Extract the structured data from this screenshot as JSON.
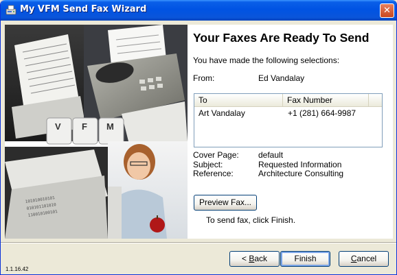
{
  "window": {
    "title": "My VFM Send Fax Wizard",
    "close_glyph": "✕",
    "icon": "fax-app-icon"
  },
  "side_image": {
    "keys": [
      "V",
      "F",
      "M"
    ],
    "description_icon": "fax-collage-image"
  },
  "panel": {
    "heading": "Your Faxes Are Ready To Send",
    "intro": "You have made the following selections:",
    "from_label": "From:",
    "from_value": "Ed Vandalay",
    "recipients": {
      "columns": [
        "To",
        "Fax Number"
      ],
      "rows": [
        {
          "to": "Art Vandalay",
          "fax": "+1 (281) 664-9987"
        }
      ]
    },
    "details": [
      {
        "label": "Cover Page:",
        "value": "default"
      },
      {
        "label": "Subject:",
        "value": "Requested Information"
      },
      {
        "label": "Reference:",
        "value": "Architecture Consulting"
      }
    ],
    "preview_button": "Preview Fax...",
    "instruction": "To send fax, click Finish."
  },
  "footer": {
    "version": "1.1.16.42",
    "back": {
      "mnemonic": "B",
      "rest": "ack",
      "prefix": "< "
    },
    "finish": "Finish",
    "cancel": {
      "mnemonic": "C",
      "rest": "ancel"
    }
  },
  "colors": {
    "titlebar": "#0053e3",
    "dialog_bg": "#ece9d8",
    "button_border": "#003c74",
    "close_button": "#c9461f"
  }
}
